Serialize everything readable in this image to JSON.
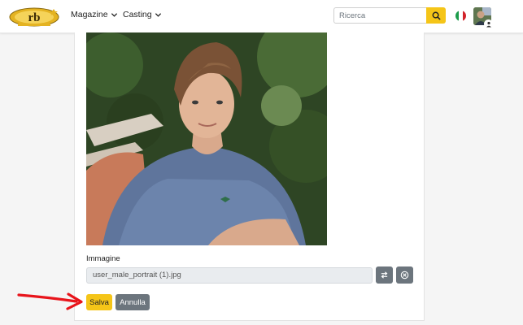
{
  "header": {
    "logo_icon": "rb-logo",
    "nav": [
      {
        "label": "Magazine",
        "icon": "chevron-down-icon"
      },
      {
        "label": "Casting",
        "icon": "chevron-down-icon"
      }
    ],
    "search": {
      "placeholder": "Ricerca",
      "value": "",
      "icon": "search-icon"
    },
    "language_icon": "italy-flag-icon",
    "avatar_icon": "user-avatar"
  },
  "form": {
    "image_label": "Immagine",
    "file_name": "user_male_portrait (1).jpg",
    "replace_icon": "swap-icon",
    "remove_icon": "close-circle-icon",
    "save_label": "Salva",
    "cancel_label": "Annulla"
  },
  "colors": {
    "accent": "#f5c518",
    "secondary": "#6c757d",
    "annotation": "#e8141b"
  }
}
